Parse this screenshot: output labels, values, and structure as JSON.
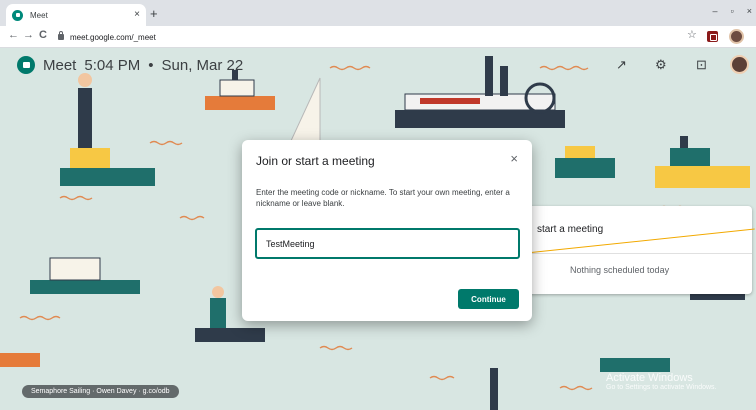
{
  "browser": {
    "tab_title": "Meet",
    "new_tab_label": "+",
    "url": "meet.google.com/_meet",
    "back_icon": "←",
    "forward_icon": "→",
    "reload_icon": "C",
    "close_tab_icon": "×",
    "star_icon": "☆",
    "window_controls": {
      "minimize": "–",
      "maximize": "▫",
      "close": "×"
    }
  },
  "meet": {
    "app_name": "Meet",
    "time": "5:04 PM",
    "separator": "•",
    "date": "Sun, Mar 22",
    "icons": {
      "trend": "↗",
      "settings": "⚙",
      "feedback": "⊡"
    }
  },
  "side_panel": {
    "start_label": "start a meeting",
    "none_label": "Nothing scheduled today"
  },
  "dialog": {
    "title": "Join or start a meeting",
    "close_icon": "×",
    "body": "Enter the meeting code or nickname. To start your own meeting, enter a nickname or leave blank.",
    "input_value": "TestMeeting",
    "continue_label": "Continue"
  },
  "credit": "Semaphore Sailing · Owen Davey · g.co/odb",
  "watermark": {
    "title": "Activate Windows",
    "subtitle": "Go to Settings to activate Windows."
  },
  "colors": {
    "accent": "#00796b",
    "tabbar": "#dee1e6",
    "background": "#d8e6e2",
    "pointer_line": "#f2a900"
  }
}
